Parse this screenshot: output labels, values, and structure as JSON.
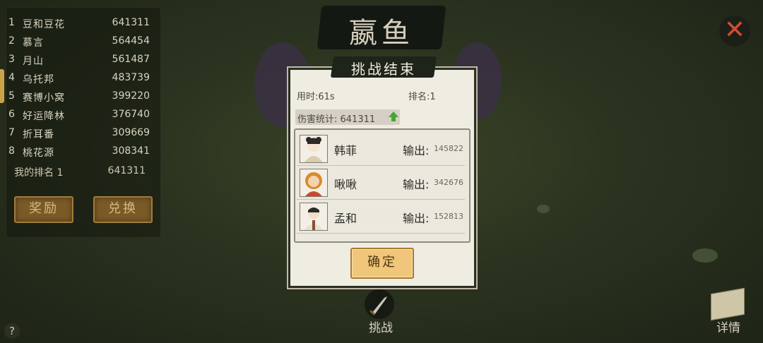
{
  "leaderboard": {
    "rows": [
      {
        "rank": "1",
        "name": "豆和豆花",
        "score": "641311"
      },
      {
        "rank": "2",
        "name": "慕言",
        "score": "564454"
      },
      {
        "rank": "3",
        "name": "月山",
        "score": "561487"
      },
      {
        "rank": "4",
        "name": "乌托邦",
        "score": "483739"
      },
      {
        "rank": "5",
        "name": "赛博小窝",
        "score": "399220"
      },
      {
        "rank": "6",
        "name": "好运降林",
        "score": "376740"
      },
      {
        "rank": "7",
        "name": "折耳番",
        "score": "309669"
      },
      {
        "rank": "8",
        "name": "桃花源",
        "score": "308341"
      }
    ],
    "my_rank_label": "我的排名 1",
    "my_score": "641311",
    "reward_button": "奖励",
    "exchange_button": "兑换"
  },
  "header": {
    "title": "嬴鱼"
  },
  "modal": {
    "title": "挑战结束",
    "time_label": "用时:61s",
    "rank_label": "排名:1",
    "damage_label": "伤害统计: 641311",
    "heroes": [
      {
        "name": "韩菲",
        "output_label": "输出:",
        "output_value": "145822"
      },
      {
        "name": "啾啾",
        "output_label": "输出:",
        "output_value": "342676"
      },
      {
        "name": "孟和",
        "output_label": "输出:",
        "output_value": "152813"
      }
    ],
    "confirm_button": "确定"
  },
  "bottom": {
    "challenge_label": "挑战",
    "details_label": "详情",
    "help_label": "?"
  },
  "icons": {
    "close": "close-icon",
    "challenge": "sword-icon",
    "details": "scroll-icon",
    "damage_up": "arrow-up-icon"
  },
  "colors": {
    "accent_gold": "#f0c77a",
    "close_red": "#d54b2f",
    "up_green": "#46a534"
  }
}
